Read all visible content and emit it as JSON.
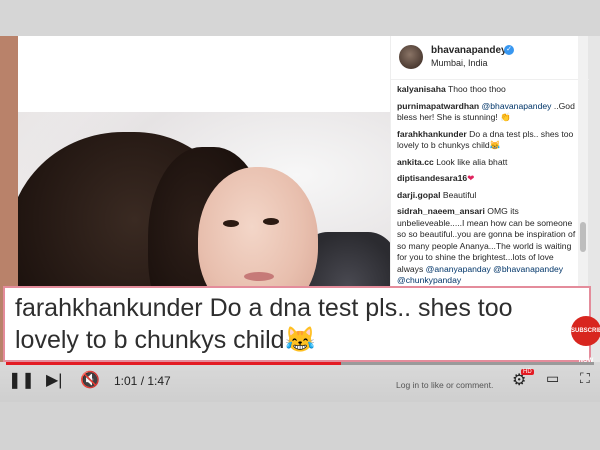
{
  "post": {
    "owner": "bhavanapandey",
    "location": "Mumbai, India",
    "comments": [
      {
        "user": "kalyanisaha",
        "text": "Thoo thoo thoo"
      },
      {
        "user": "purnimapatwardhan",
        "mention": "@bhavanapandey",
        "text": "..God bless her! She is stunning! 👏"
      },
      {
        "user": "farahkhankunder",
        "text": "Do a dna test pls.. shes too lovely to b chunkys child😹"
      },
      {
        "user": "ankita.cc",
        "text": "Look like alia bhatt"
      },
      {
        "user": "diptisandesara16",
        "text": "❤"
      },
      {
        "user": "darji.gopal",
        "text": "Beautiful"
      },
      {
        "user": "sidrah_naeem_ansari",
        "text": "OMG its unbelieveable.....I mean how can be someone so so beautiful..you are gonna be inspiration of so many people Ananya...The world is waiting for you to shine the brightest...lots of love always",
        "mentions": "@ananyapanday @bhavanapandey @chunkypanday"
      }
    ]
  },
  "caption": {
    "text": "farahkhankunder Do a dna test pls.. shes too lovely to b chunkys child😹"
  },
  "subscribe": {
    "label": "SUBSCRIBE NOW"
  },
  "player": {
    "time": "1:01 / 1:47",
    "progress": 0.57,
    "login_text": "Log in to like or comment.",
    "hd_label": "HD",
    "play_icon": "pause-icon",
    "next_icon": "next-icon",
    "mute_icon": "mute-icon",
    "settings_icon": "gear-icon",
    "theater_icon": "theater-icon",
    "fullscreen_icon": "fullscreen-icon"
  },
  "colors": {
    "accent_red": "#e31b23",
    "verified_blue": "#3897f0",
    "caption_border": "#e48c9b"
  }
}
